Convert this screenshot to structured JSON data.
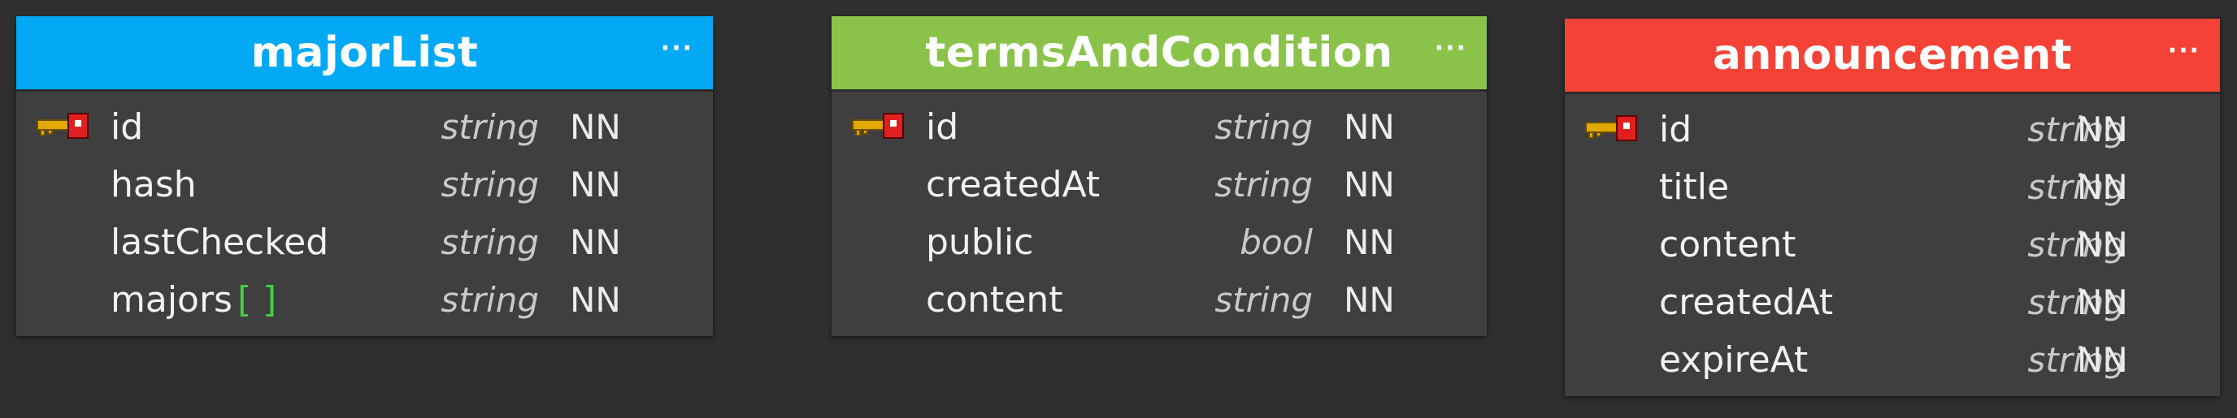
{
  "colors": {
    "majorList_header": "#03a9f4",
    "termsAndCondition_header": "#8bc34a",
    "announcement_header": "#f44336",
    "table_body": "#3f3f3f",
    "canvas": "#2f2f2f",
    "array_marker": "#3fcf3f"
  },
  "tables": [
    {
      "name": "majorList",
      "menu_icon": "ellipsis-icon",
      "menu_label": "···",
      "columns": [
        {
          "name": "id",
          "type": "string",
          "nn": "NN",
          "pk": true,
          "pk_icon": "key-icon"
        },
        {
          "name": "hash",
          "type": "string",
          "nn": "NN"
        },
        {
          "name": "lastChecked",
          "type": "string",
          "nn": "NN"
        },
        {
          "name": "majors",
          "array_marker": "[ ]",
          "type": "string",
          "nn": "NN"
        }
      ]
    },
    {
      "name": "termsAndCondition",
      "menu_icon": "ellipsis-icon",
      "menu_label": "···",
      "columns": [
        {
          "name": "id",
          "type": "string",
          "nn": "NN",
          "pk": true,
          "pk_icon": "key-icon"
        },
        {
          "name": "createdAt",
          "type": "string",
          "nn": "NN"
        },
        {
          "name": "public",
          "type": "bool",
          "nn": "NN"
        },
        {
          "name": "content",
          "type": "string",
          "nn": "NN"
        }
      ]
    },
    {
      "name": "announcement",
      "menu_icon": "ellipsis-icon",
      "menu_label": "···",
      "columns": [
        {
          "name": "id",
          "type": "string",
          "nn": "NN",
          "pk": true,
          "pk_icon": "key-icon"
        },
        {
          "name": "title",
          "type": "string",
          "nn": "NN"
        },
        {
          "name": "content",
          "type": "string",
          "nn": "NN"
        },
        {
          "name": "createdAt",
          "type": "string",
          "nn": "NN"
        },
        {
          "name": "expireAt",
          "type": "string",
          "nn": "NN"
        }
      ]
    }
  ]
}
